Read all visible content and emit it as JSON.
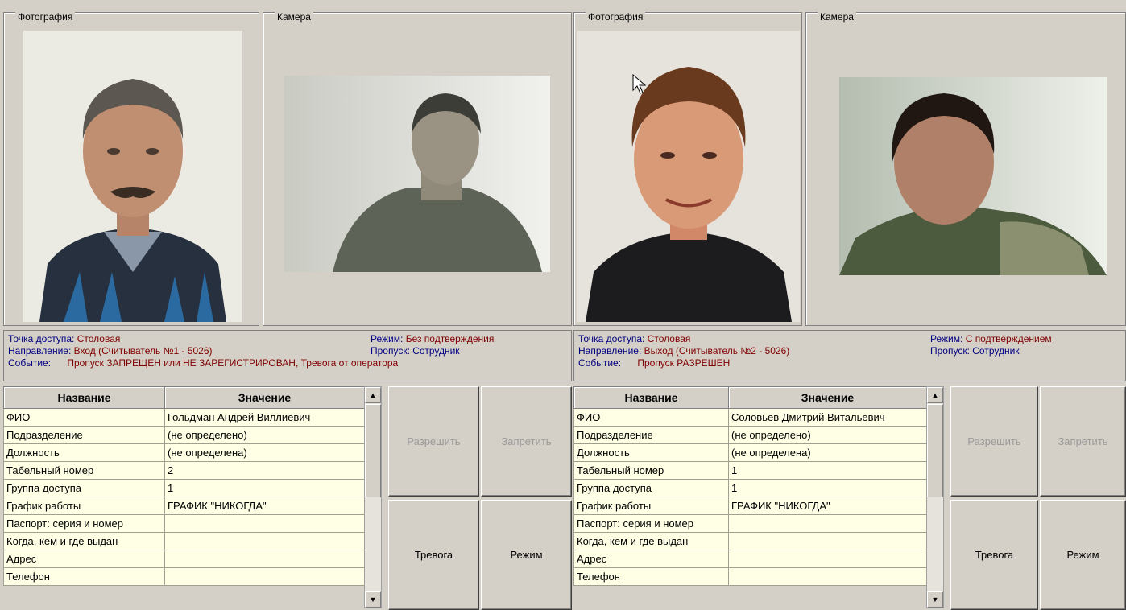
{
  "panels": [
    {
      "photo_label": "Фотография",
      "camera_label": "Камера",
      "info": {
        "access_point_label": "Точка доступа:",
        "access_point": "Столовая",
        "direction_label": "Направление:",
        "direction": "Вход (Считыватель №1 - 5026)",
        "event_label": "Событие:",
        "event": "Пропуск ЗАПРЕЩЕН или НЕ ЗАРЕГИСТРИРОВАН, Тревога от оператора",
        "mode_label": "Режим:",
        "mode": "Без подтверждения",
        "pass_label": "Пропуск:",
        "pass": "Сотрудник"
      },
      "table": {
        "headers": [
          "Название",
          "Значение"
        ],
        "rows": [
          [
            "ФИО",
            "Гольдман Андрей Виллиевич"
          ],
          [
            "Подразделение",
            "(не определено)"
          ],
          [
            "Должность",
            "(не определена)"
          ],
          [
            "Табельный номер",
            "2"
          ],
          [
            "Группа доступа",
            "1"
          ],
          [
            "График работы",
            "ГРАФИК \"НИКОГДА\""
          ],
          [
            "Паспорт: серия и номер",
            ""
          ],
          [
            "Когда, кем и где выдан",
            ""
          ],
          [
            "Адрес",
            ""
          ],
          [
            "Телефон",
            ""
          ]
        ]
      },
      "buttons": {
        "allow": "Разрешить",
        "deny": "Запретить",
        "alarm": "Тревога",
        "mode": "Режим"
      }
    },
    {
      "photo_label": "Фотография",
      "camera_label": "Камера",
      "info": {
        "access_point_label": "Точка доступа:",
        "access_point": "Столовая",
        "direction_label": "Направление:",
        "direction": "Выход (Считыватель №2 - 5026)",
        "event_label": "Событие:",
        "event": "Пропуск РАЗРЕШЕН",
        "mode_label": "Режим:",
        "mode": "С подтверждением",
        "pass_label": "Пропуск:",
        "pass": "Сотрудник"
      },
      "table": {
        "headers": [
          "Название",
          "Значение"
        ],
        "rows": [
          [
            "ФИО",
            "Соловьев Дмитрий Витальевич"
          ],
          [
            "Подразделение",
            "(не определено)"
          ],
          [
            "Должность",
            "(не определена)"
          ],
          [
            "Табельный номер",
            "1"
          ],
          [
            "Группа доступа",
            "1"
          ],
          [
            "График работы",
            "ГРАФИК \"НИКОГДА\""
          ],
          [
            "Паспорт: серия и номер",
            ""
          ],
          [
            "Когда, кем и где выдан",
            ""
          ],
          [
            "Адрес",
            ""
          ],
          [
            "Телефон",
            ""
          ]
        ]
      },
      "buttons": {
        "allow": "Разрешить",
        "deny": "Запретить",
        "alarm": "Тревога",
        "mode": "Режим"
      }
    }
  ]
}
